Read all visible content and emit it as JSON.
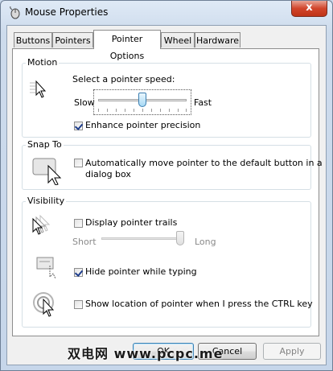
{
  "window": {
    "title": "Mouse Properties",
    "close_glyph": "x",
    "icon": "mouse-icon"
  },
  "tabs": [
    {
      "label": "Buttons",
      "active": false
    },
    {
      "label": "Pointers",
      "active": false
    },
    {
      "label": "Pointer Options",
      "active": true
    },
    {
      "label": "Wheel",
      "active": false
    },
    {
      "label": "Hardware",
      "active": false
    }
  ],
  "motion": {
    "group_title": "Motion",
    "speed_label": "Select a pointer speed:",
    "slow_label": "Slow",
    "fast_label": "Fast",
    "speed_level": 0.5,
    "precision_label": "Enhance pointer precision",
    "precision_checked": true
  },
  "snap_to": {
    "group_title": "Snap To",
    "snap_label_line1": "Automatically move pointer to the default button in a",
    "snap_label_line2": "dialog box",
    "snap_checked": false
  },
  "visibility": {
    "group_title": "Visibility",
    "trails_label": "Display pointer trails",
    "trails_checked": false,
    "short_label": "Short",
    "long_label": "Long",
    "trail_level": 1.0,
    "hide_label": "Hide pointer while typing",
    "hide_checked": true,
    "show_location_label": "Show location of pointer when I press the CTRL key",
    "show_location_checked": false
  },
  "buttons": {
    "ok": "OK",
    "cancel": "Cancel",
    "apply": "Apply"
  },
  "watermark": "双电网 www.pcpc.me",
  "colors": {
    "accent": "#3c7fb1",
    "close": "#c7381c",
    "window_frame": "#c9d9ec"
  }
}
